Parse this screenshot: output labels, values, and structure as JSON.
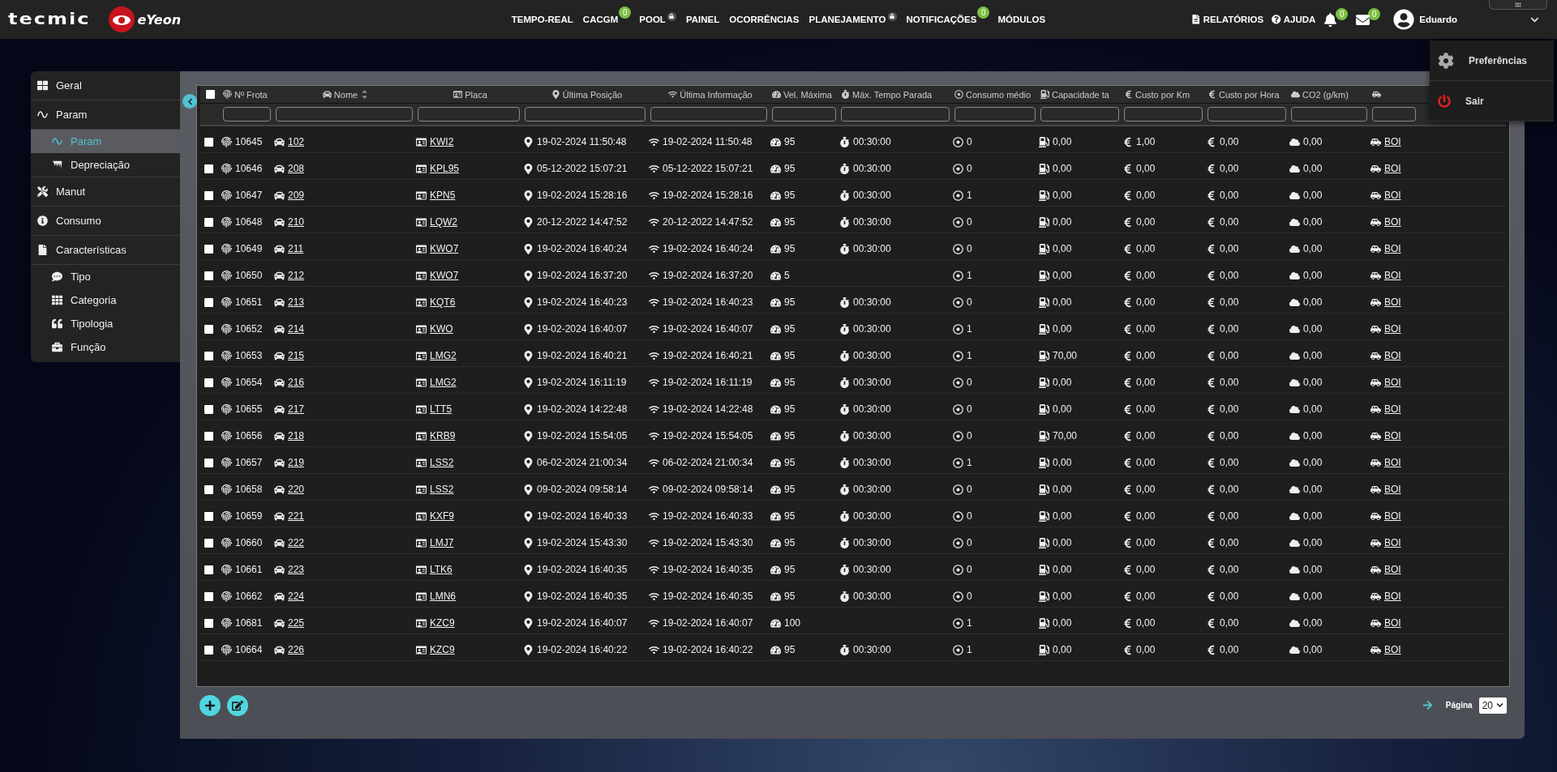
{
  "brand": {
    "company": "tecmic",
    "product": "eYeon"
  },
  "nav": [
    {
      "label": "TEMPO-REAL",
      "locked": false
    },
    {
      "label": "CACGM",
      "badge": "0",
      "locked": false
    },
    {
      "label": "POOL",
      "locked": true
    },
    {
      "label": "PAINEL",
      "locked": false
    },
    {
      "label": "OCORRÊNCIAS",
      "locked": false
    },
    {
      "label": "PLANEJAMENTO",
      "locked": true
    },
    {
      "label": "NOTIFICAÇÕES",
      "badge": "0",
      "locked": false
    },
    {
      "label": "MÓDULOS",
      "locked": false
    }
  ],
  "toolbar": {
    "reports": "RELATÓRIOS",
    "help": "AJUDA",
    "notifications_badge": "0",
    "messages_badge": "0",
    "user": "Eduardo"
  },
  "user_menu": {
    "open": true,
    "items": [
      "Preferências",
      "Sair"
    ]
  },
  "sidebar": {
    "items": [
      {
        "label": "Geral",
        "selected": false
      },
      {
        "label": "Param",
        "selected": false,
        "children": [
          {
            "label": "Param",
            "selected": true
          },
          {
            "label": "Depreciação",
            "selected": false
          }
        ]
      },
      {
        "label": "Manut",
        "selected": false
      },
      {
        "label": "Consumo",
        "selected": false
      },
      {
        "label": "Características",
        "selected": false,
        "children": [
          {
            "label": "Tipo",
            "selected": false
          },
          {
            "label": "Categoria",
            "selected": false
          },
          {
            "label": "Tipologia",
            "selected": false
          },
          {
            "label": "Função",
            "selected": false
          }
        ]
      }
    ]
  },
  "table": {
    "select_all": {
      "checked": false
    },
    "columns": [
      {
        "label": "Nº Frota",
        "link": false
      },
      {
        "label": "Nome",
        "sortable": true,
        "link": true
      },
      {
        "label": "Placa",
        "link": true
      },
      {
        "label": "Última Posição",
        "link": false
      },
      {
        "label": "Última Informação",
        "link": false
      },
      {
        "label": "Vel. Máxima",
        "link": false
      },
      {
        "label": "Máx. Tempo Parada",
        "link": false
      },
      {
        "label": "Consumo médio",
        "link": false
      },
      {
        "label": "Capacidade ta",
        "link": false
      },
      {
        "label": "Custo por Km",
        "link": false
      },
      {
        "label": "Custo por Hora",
        "link": false
      },
      {
        "label": "CO2 (g/km)",
        "link": false
      },
      {
        "link": true
      }
    ],
    "rows": [
      {
        "checked": false,
        "cells": [
          "10645",
          "102",
          "KWI2",
          "19-02-2024 11:50:48",
          "19-02-2024 11:50:48",
          "95",
          "00:30:00",
          "0",
          "0,00",
          "1,00",
          "0,00",
          "0,00",
          "BOI"
        ]
      },
      {
        "checked": false,
        "cells": [
          "10646",
          "208",
          "KPL95",
          "05-12-2022 15:07:21",
          "05-12-2022 15:07:21",
          "95",
          "00:30:00",
          "0",
          "0,00",
          "0,00",
          "0,00",
          "0,00",
          "BOI"
        ]
      },
      {
        "checked": false,
        "cells": [
          "10647",
          "209",
          "KPN5",
          "19-02-2024 15:28:16",
          "19-02-2024 15:28:16",
          "95",
          "00:30:00",
          "1",
          "0,00",
          "0,00",
          "0,00",
          "0,00",
          "BOI"
        ]
      },
      {
        "checked": false,
        "cells": [
          "10648",
          "210",
          "LQW2",
          "20-12-2022 14:47:52",
          "20-12-2022 14:47:52",
          "95",
          "00:30:00",
          "0",
          "0,00",
          "0,00",
          "0,00",
          "0,00",
          "BOI"
        ]
      },
      {
        "checked": false,
        "cells": [
          "10649",
          "211",
          "KWO7",
          "19-02-2024 16:40:24",
          "19-02-2024 16:40:24",
          "95",
          "00:30:00",
          "0",
          "0,00",
          "0,00",
          "0,00",
          "0,00",
          "BOI"
        ]
      },
      {
        "checked": false,
        "cells": [
          "10650",
          "212",
          "KWO7",
          "19-02-2024 16:37:20",
          "19-02-2024 16:37:20",
          "5",
          null,
          "1",
          "0,00",
          "0,00",
          "0,00",
          "0,00",
          "BOI"
        ]
      },
      {
        "checked": false,
        "cells": [
          "10651",
          "213",
          "KQT6",
          "19-02-2024 16:40:23",
          "19-02-2024 16:40:23",
          "95",
          "00:30:00",
          "0",
          "0,00",
          "0,00",
          "0,00",
          "0,00",
          "BOI"
        ]
      },
      {
        "checked": false,
        "cells": [
          "10652",
          "214",
          "KWO",
          "19-02-2024 16:40:07",
          "19-02-2024 16:40:07",
          "95",
          "00:30:00",
          "1",
          "0,00",
          "0,00",
          "0,00",
          "0,00",
          "BOI"
        ]
      },
      {
        "checked": false,
        "cells": [
          "10653",
          "215",
          "LMG2",
          "19-02-2024 16:40:21",
          "19-02-2024 16:40:21",
          "95",
          "00:30:00",
          "1",
          "70,00",
          "0,00",
          "0,00",
          "0,00",
          "BOI"
        ]
      },
      {
        "checked": false,
        "cells": [
          "10654",
          "216",
          "LMG2",
          "19-02-2024 16:11:19",
          "19-02-2024 16:11:19",
          "95",
          "00:30:00",
          "0",
          "0,00",
          "0,00",
          "0,00",
          "0,00",
          "BOI"
        ]
      },
      {
        "checked": false,
        "cells": [
          "10655",
          "217",
          "LTT5",
          "19-02-2024 14:22:48",
          "19-02-2024 14:22:48",
          "95",
          "00:30:00",
          "0",
          "0,00",
          "0,00",
          "0,00",
          "0,00",
          "BOI"
        ]
      },
      {
        "checked": false,
        "cells": [
          "10656",
          "218",
          "KRB9",
          "19-02-2024 15:54:05",
          "19-02-2024 15:54:05",
          "95",
          "00:30:00",
          "0",
          "70,00",
          "0,00",
          "0,00",
          "0,00",
          "BOI"
        ]
      },
      {
        "checked": false,
        "cells": [
          "10657",
          "219",
          "LSS2",
          "06-02-2024 21:00:34",
          "06-02-2024 21:00:34",
          "95",
          "00:30:00",
          "1",
          "0,00",
          "0,00",
          "0,00",
          "0,00",
          "BOI"
        ]
      },
      {
        "checked": false,
        "cells": [
          "10658",
          "220",
          "LSS2",
          "09-02-2024 09:58:14",
          "09-02-2024 09:58:14",
          "95",
          "00:30:00",
          "0",
          "0,00",
          "0,00",
          "0,00",
          "0,00",
          "BOI"
        ]
      },
      {
        "checked": false,
        "cells": [
          "10659",
          "221",
          "KXF9",
          "19-02-2024 16:40:33",
          "19-02-2024 16:40:33",
          "95",
          "00:30:00",
          "0",
          "0,00",
          "0,00",
          "0,00",
          "0,00",
          "BOI"
        ]
      },
      {
        "checked": false,
        "cells": [
          "10660",
          "222",
          "LMJ7",
          "19-02-2024 15:43:30",
          "19-02-2024 15:43:30",
          "95",
          "00:30:00",
          "0",
          "0,00",
          "0,00",
          "0,00",
          "0,00",
          "BOI"
        ]
      },
      {
        "checked": false,
        "cells": [
          "10661",
          "223",
          "LTK6",
          "19-02-2024 16:40:35",
          "19-02-2024 16:40:35",
          "95",
          "00:30:00",
          "0",
          "0,00",
          "0,00",
          "0,00",
          "0,00",
          "BOI"
        ]
      },
      {
        "checked": false,
        "cells": [
          "10662",
          "224",
          "LMN6",
          "19-02-2024 16:40:35",
          "19-02-2024 16:40:35",
          "95",
          "00:30:00",
          "0",
          "0,00",
          "0,00",
          "0,00",
          "0,00",
          "BOI"
        ]
      },
      {
        "checked": false,
        "cells": [
          "10681",
          "225",
          "KZC9",
          "19-02-2024 16:40:07",
          "19-02-2024 16:40:07",
          "100",
          null,
          "1",
          "0,00",
          "0,00",
          "0,00",
          "0,00",
          "BOI"
        ]
      },
      {
        "checked": false,
        "cells": [
          "10664",
          "226",
          "KZC9",
          "19-02-2024 16:40:22",
          "19-02-2024 16:40:22",
          "95",
          "00:30:00",
          "1",
          "0,00",
          "0,00",
          "0,00",
          "0,00",
          "BOI"
        ]
      }
    ]
  },
  "pagination": {
    "label": "Página",
    "page_size": "20"
  }
}
